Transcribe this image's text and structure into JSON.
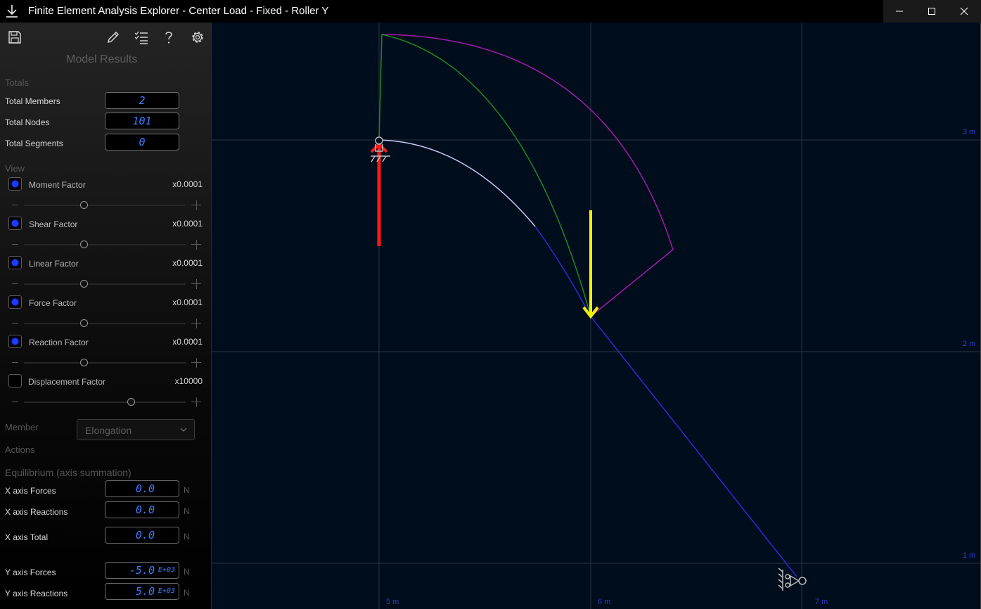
{
  "window": {
    "title": "Finite Element Analysis Explorer - Center Load - Fixed - Roller Y"
  },
  "sidebar": {
    "title": "Model Results",
    "totals": {
      "header": "Totals",
      "members_label": "Total Members",
      "members_value": "2",
      "nodes_label": "Total Nodes",
      "nodes_value": "101",
      "segments_label": "Total Segments",
      "segments_value": "0"
    },
    "view": {
      "header": "View",
      "factors": [
        {
          "label": "Moment Factor",
          "value": "x0.0001",
          "checked": true,
          "slider": 0.37
        },
        {
          "label": "Shear Factor",
          "value": "x0.0001",
          "checked": true,
          "slider": 0.37
        },
        {
          "label": "Linear Factor",
          "value": "x0.0001",
          "checked": true,
          "slider": 0.37
        },
        {
          "label": "Force Factor",
          "value": "x0.0001",
          "checked": true,
          "slider": 0.37
        },
        {
          "label": "Reaction Factor",
          "value": "x0.0001",
          "checked": true,
          "slider": 0.37
        },
        {
          "label": "Displacement Factor",
          "value": "x10000",
          "checked": false,
          "slider": 0.66
        }
      ]
    },
    "member": {
      "label": "Member",
      "selected": "Elongation"
    },
    "actions": {
      "header": "Actions"
    },
    "equilibrium": {
      "header": "Equilibrium (axis summation)",
      "rows": [
        {
          "label": "X axis Forces",
          "value": "0.0",
          "exp": "",
          "unit": "N"
        },
        {
          "label": "X axis Reactions",
          "value": "0.0",
          "exp": "",
          "unit": "N"
        },
        {
          "label": "X axis Total",
          "value": "0.0",
          "exp": "",
          "unit": "N"
        },
        {
          "label": "Y axis Forces",
          "value": "-5.0",
          "exp": "E+03",
          "unit": "N"
        },
        {
          "label": "Y axis Reactions",
          "value": "5.0",
          "exp": "E+03",
          "unit": "N"
        }
      ]
    }
  },
  "canvas": {
    "x_axis_labels": [
      "5 m",
      "6 m",
      "7 m"
    ],
    "y_axis_labels": [
      "3 m",
      "2 m",
      "1 m"
    ],
    "colors": {
      "background": "#000d1d",
      "grid": "#2a3442",
      "member_original": "#c8c8f0",
      "member_deflected": "#2b2bd8",
      "moment_diagram": "#a41aa8",
      "shear_diagram": "#1f8a1f",
      "applied_force": "#f2f200",
      "reaction_force": "#ff1a1a"
    }
  },
  "icons": {
    "app": "download-arrow-icon",
    "save": "save-icon",
    "edit": "pencil-icon",
    "checklist": "checklist-icon",
    "help": "question-icon",
    "settings": "gear-icon"
  }
}
